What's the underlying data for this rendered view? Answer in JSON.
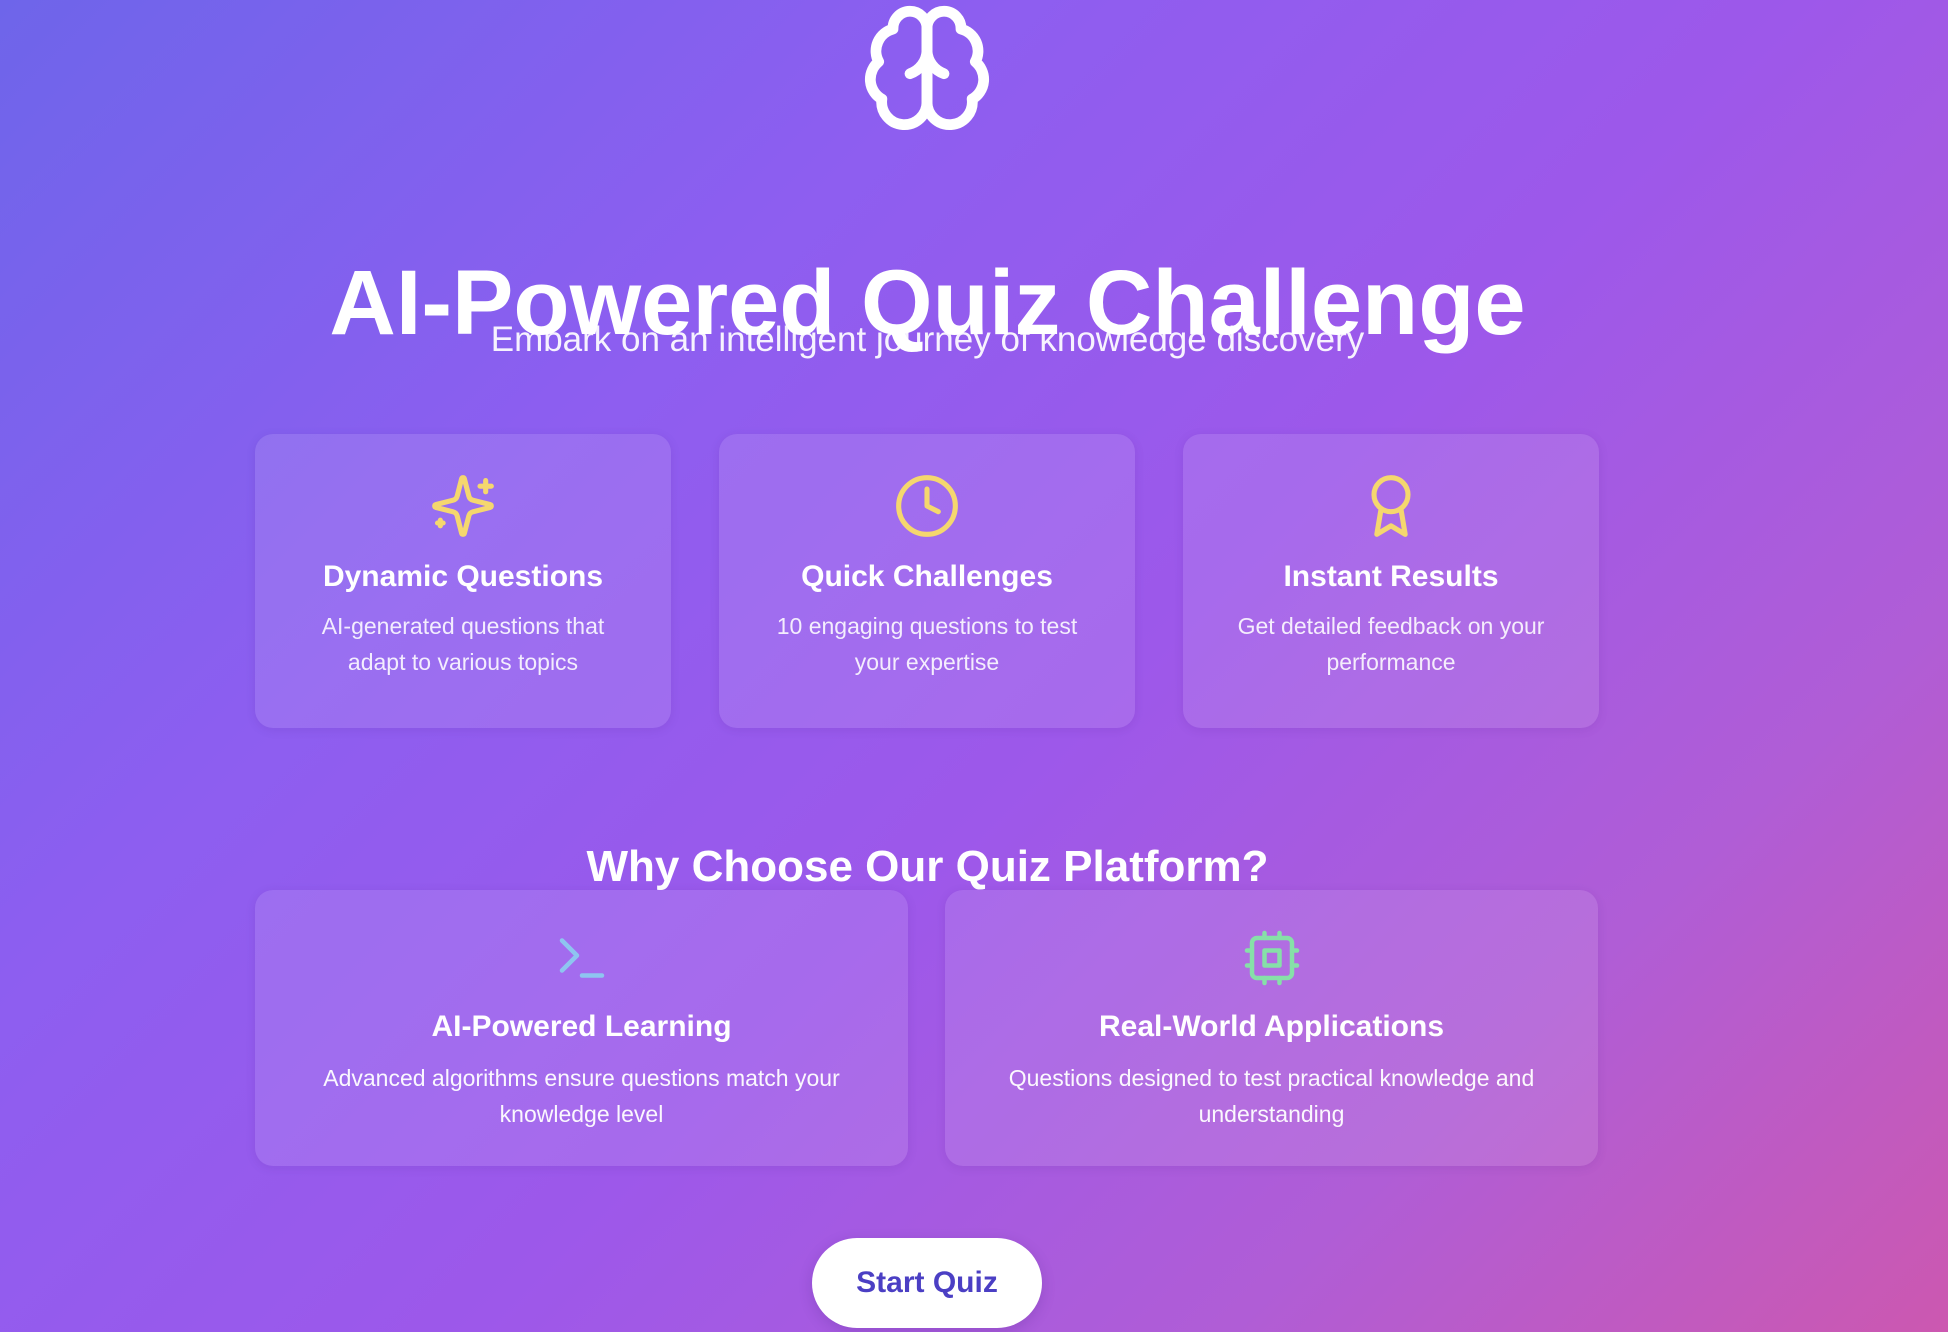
{
  "hero": {
    "logo_icon": "brain-icon",
    "title": "AI-Powered Quiz Challenge",
    "subtitle": "Embark on an intelligent journey of knowledge discovery"
  },
  "features": [
    {
      "icon": "sparkles-icon",
      "icon_color": "#f5d76e",
      "title": "Dynamic Questions",
      "description": "AI-generated questions that adapt to various topics"
    },
    {
      "icon": "clock-icon",
      "icon_color": "#f5d76e",
      "title": "Quick Challenges",
      "description": "10 engaging questions to test your expertise"
    },
    {
      "icon": "award-icon",
      "icon_color": "#f5d76e",
      "title": "Instant Results",
      "description": "Get detailed feedback on your performance"
    }
  ],
  "why": {
    "title": "Why Choose Our Quiz Platform?",
    "items": [
      {
        "icon": "terminal-icon",
        "icon_color": "#8ec5f0",
        "title": "AI-Powered Learning",
        "description": "Advanced algorithms ensure questions match your knowledge level"
      },
      {
        "icon": "cpu-icon",
        "icon_color": "#86e0a8",
        "title": "Real-World Applications",
        "description": "Questions designed to test practical knowledge and understanding"
      }
    ]
  },
  "cta": {
    "start_label": "Start Quiz"
  },
  "colors": {
    "gradient_start": "#6e65ea",
    "gradient_end": "#cc58b0",
    "button_text": "#4b3fc4"
  }
}
